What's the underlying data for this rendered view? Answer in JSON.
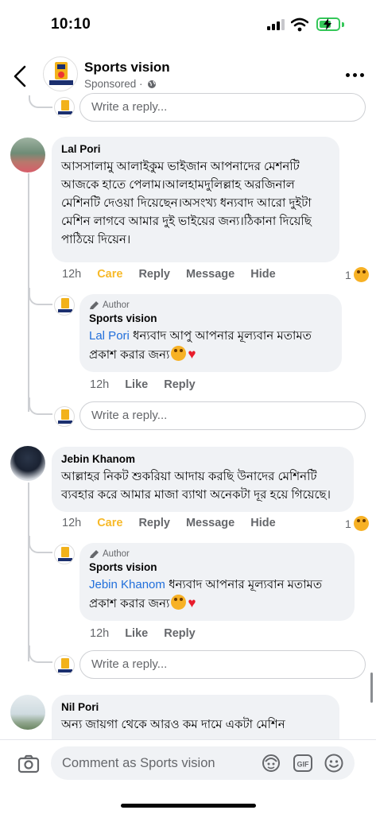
{
  "status_bar": {
    "time": "10:10"
  },
  "header": {
    "page_name": "Sports vision",
    "subtitle": "Sponsored ·",
    "logo_text": "SPORTS VISION"
  },
  "top_reply": {
    "placeholder": "Write a reply..."
  },
  "comments": [
    {
      "name": "Lal Pori",
      "text": "আসসালামু আলাইকুম ভাইজান আপনাদের মেশনটি আজকে হাতে পেলাম।আলহামদুলিল্লাহ অরজিনাল মেশিনটি দেওয়া দিয়েছেন।অসংখ্য ধন্যবাদ আরো দুইটা মেশিন লাগবে আমার দুই ভাইয়ের জন্য।ঠিকানা দিয়েছি পাঠিয়ে দিয়েন।",
      "time": "12h",
      "reaction_label": "Care",
      "reply_label": "Reply",
      "message_label": "Message",
      "hide_label": "Hide",
      "reaction_count": "1",
      "reply": {
        "badge": "Author",
        "name": "Sports vision",
        "mention": "Lal Pori",
        "text": " ধন্যবাদ আপু আপনার মূল্যবান মতামত প্রকাশ করার জন্য",
        "time": "12h",
        "like_label": "Like",
        "reply_label": "Reply"
      },
      "reply_placeholder": "Write a reply..."
    },
    {
      "name": "Jebin Khanom",
      "text": "আল্লাহর নিকট শুকরিয়া আদায় করছি উনাদের মেশিনটি ব্যবহার করে আমার মাজা ব্যাথা অনেকটা দূর হয়ে গিয়েছে।",
      "time": "12h",
      "reaction_label": "Care",
      "reply_label": "Reply",
      "message_label": "Message",
      "hide_label": "Hide",
      "reaction_count": "1",
      "reply": {
        "badge": "Author",
        "name": "Sports vision",
        "mention": "Jebin Khanom",
        "text": " ধন্যবাদ আপনার মূল্যবান মতামত প্রকাশ করার জন্য",
        "time": "12h",
        "like_label": "Like",
        "reply_label": "Reply"
      },
      "reply_placeholder": "Write a reply..."
    },
    {
      "name": "Nil Pori",
      "text": "অন্য জায়গা থেকে আরও কম দামে একটা মেশিন"
    }
  ],
  "bottom_bar": {
    "comment_placeholder": "Comment as Sports vision"
  },
  "colors": {
    "care": "#f7b928",
    "mention": "#216fdb",
    "bubble": "#f0f2f5",
    "muted": "#65676b"
  }
}
